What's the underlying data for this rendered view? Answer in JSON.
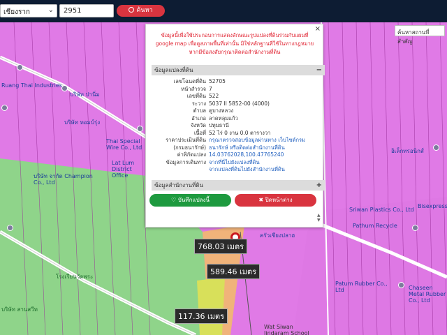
{
  "toolbar": {
    "province_select": "เชียงราก",
    "number_value": "2951",
    "search_label": "ค้นหา"
  },
  "map": {
    "search_place_placeholder": "ค้นหาสถานที่สำคัญ",
    "labels": [
      {
        "text": "Ruang Thai Industries",
        "cls": ""
      },
      {
        "text": "บริษัท ปานิ่ม",
        "cls": ""
      },
      {
        "text": "บริษัท ทอมบ์รุ่ง",
        "cls": ""
      },
      {
        "text": "Thai Special Wire Co., Ltd",
        "cls": ""
      },
      {
        "text": "Lat Lum District Office",
        "cls": ""
      },
      {
        "text": "บริษัท จากัด Champion Co., Ltd",
        "cls": ""
      },
      {
        "text": "โรงเรียนวัดพระ",
        "cls": ""
      },
      {
        "text": "บริษัท สานสวีท",
        "cls": ""
      },
      {
        "text": "Wat Siwan Jindaram School",
        "cls": ""
      },
      {
        "text": "Sriwan Plastics Co., Ltd",
        "cls": ""
      },
      {
        "text": "Pathum Recycle",
        "cls": ""
      },
      {
        "text": "Patum Rubber Co., Ltd",
        "cls": ""
      },
      {
        "text": "Chaseen Metal Rubber Co., Ltd",
        "cls": ""
      },
      {
        "text": "ครัวเชียงปลาฮ",
        "cls": ""
      },
      {
        "text": "Bisexpress",
        "cls": ""
      },
      {
        "text": "อิเล็กทรอนิกส์",
        "cls": ""
      }
    ],
    "distances": [
      "768.03 เมตร",
      "589.46 เมตร",
      "117.36 เมตร"
    ],
    "colors": {
      "magenta": "#e07ae6",
      "green": "#8fd48a",
      "orange": "#f0b37a",
      "yellow": "#d8e05a"
    }
  },
  "popup": {
    "close_symbol": "×",
    "note": "ข้อมูลนี้เพื่อใช้ประกอบการแสดงลักษณะรูปแปลงที่ดินร่วมกับแผนที่ google map เพื่อดูสภาพพื้นที่เท่านั้น มิใช่หลักฐานที่ใช้ในทางกฎหมาย หากมีข้อสงสัยกรุณาติดต่อสำนักงานที่ดิน",
    "section_parcel": "ข้อมูลแปลงที่ดิน",
    "section_parcel_toggle": "−",
    "section_office": "ข้อมูลสำนักงานที่ดิน",
    "section_office_toggle": "+",
    "rows": [
      {
        "k": "เลขโฉนดที่ดิน",
        "v": "52705"
      },
      {
        "k": "หน้าสำรวจ",
        "v": "7"
      },
      {
        "k": "เลขที่ดิน",
        "v": "522"
      },
      {
        "k": "ระวาง",
        "v": "5037 II 5852-00 (4000)"
      },
      {
        "k": "ตำบล",
        "v": "คูบางหลวง"
      },
      {
        "k": "อำเภอ",
        "v": "ลาดหลุมแก้ว"
      },
      {
        "k": "จังหวัด",
        "v": "ปทุมธานี"
      },
      {
        "k": "เนื้อที่",
        "v": "52 ไร่ 0 งาน 0.0 ตารางวา"
      },
      {
        "k": "ราคาประเมินที่ดิน",
        "v": "กรุณาตรวจสอบข้อมูลผ่านทาง เว็บไซต์กรม"
      },
      {
        "k": "(กรมธนารักษ์)",
        "v": "ธนารักษ์ หรือติดต่อสำนักงานที่ดิน"
      },
      {
        "k": "ค่าพิกัดแปลง",
        "v": "14.03762028,100.47765240"
      },
      {
        "k": "ข้อมูลการเดินทาง",
        "v": "จากที่นี่ไปยังแปลงที่ดิน"
      },
      {
        "k": "",
        "v": "จากแปลงที่ดินไปยังสำนักงานที่ดิน"
      }
    ],
    "save_label": "บันทึกแปลงนี้",
    "closewin_label": "ปิดหน้าต่าง"
  }
}
